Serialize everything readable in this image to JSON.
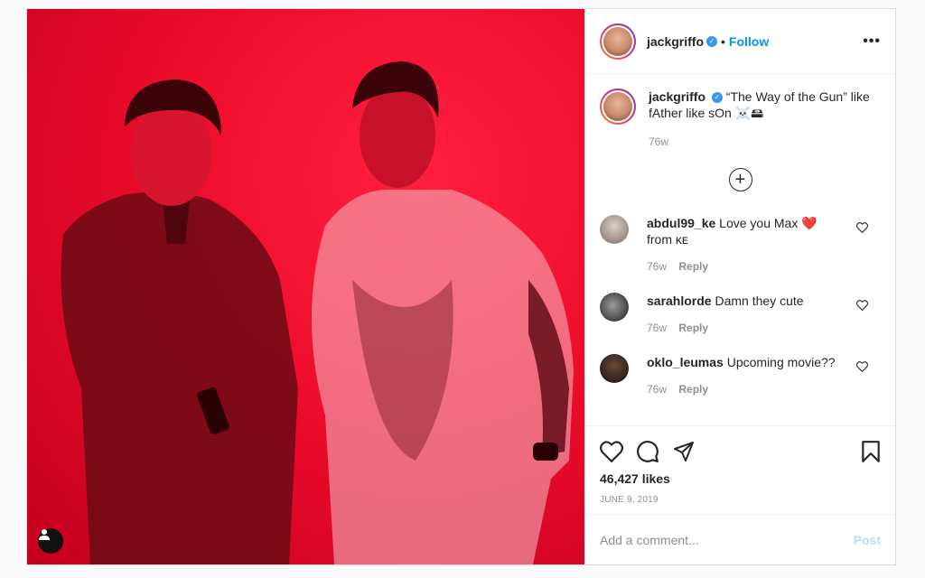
{
  "post": {
    "username": "jackgriffo",
    "follow_label": "Follow",
    "dot": "•",
    "more": "•••",
    "caption": {
      "username": "jackgriffo",
      "text": "“The Way of the Gun” like fAther like sOn ☠️🖴",
      "time": "76w"
    },
    "load_more": "+",
    "comments": [
      {
        "username": "abdul99_ke",
        "text": "Love you Max ❤️ from ᴋᴇ",
        "time": "76w",
        "reply": "Reply"
      },
      {
        "username": "sarahlorde",
        "text": "Damn they cute",
        "time": "76w",
        "reply": "Reply"
      },
      {
        "username": "oklo_leumas",
        "text": "Upcoming movie??",
        "time": "76w",
        "reply": "Reply"
      }
    ],
    "likes": "46,427 likes",
    "date": "JUNE 9, 2019",
    "add_comment_placeholder": "Add a comment...",
    "post_button": "Post"
  },
  "colors": {
    "accent": "#0095f6",
    "post_disabled": "#b2dffc",
    "photo_red": "#ee0c2c"
  }
}
